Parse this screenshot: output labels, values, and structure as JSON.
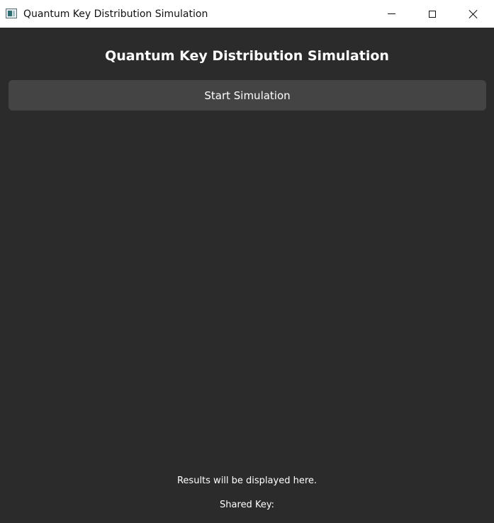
{
  "window": {
    "title": "Quantum Key Distribution Simulation",
    "controls": [
      "minimize-icon",
      "maximize-icon",
      "close-icon"
    ]
  },
  "main": {
    "heading": "Quantum Key Distribution Simulation",
    "start_button_label": "Start Simulation",
    "results_text": "Results will be displayed here.",
    "shared_key_text": "Shared Key:"
  },
  "colors": {
    "background": "#2b2b2b",
    "button": "#444444",
    "text": "#ffffff",
    "titlebar": "#ffffff"
  }
}
